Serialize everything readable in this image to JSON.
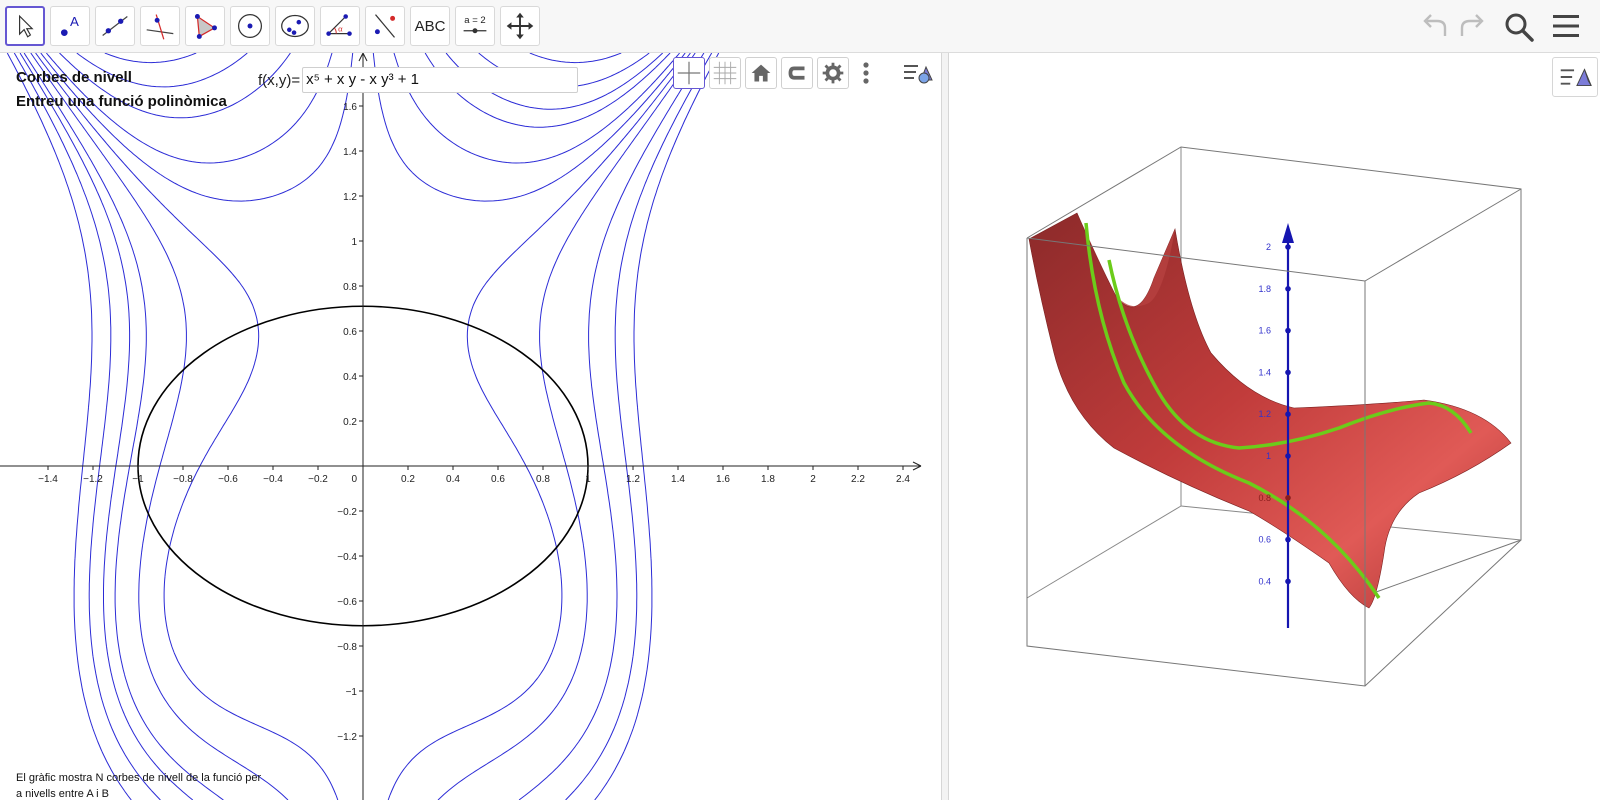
{
  "toolbar": {
    "tools": [
      {
        "id": "move",
        "name": "move-tool-button",
        "icon": "cursor-arrow-icon"
      },
      {
        "id": "point",
        "name": "point-tool-button",
        "icon": "point-icon",
        "text": "A"
      },
      {
        "id": "line",
        "name": "line-tool-button",
        "icon": "line-through-points-icon"
      },
      {
        "id": "perpendicular",
        "name": "perpendicular-line-tool-button",
        "icon": "perpendicular-line-icon"
      },
      {
        "id": "polygon",
        "name": "polygon-tool-button",
        "icon": "polygon-icon"
      },
      {
        "id": "circle",
        "name": "circle-tool-button",
        "icon": "circle-center-point-icon"
      },
      {
        "id": "conic",
        "name": "ellipse-tool-button",
        "icon": "ellipse-icon"
      },
      {
        "id": "angle",
        "name": "angle-tool-button",
        "icon": "angle-icon",
        "text": "α"
      },
      {
        "id": "reflect",
        "name": "reflect-tool-button",
        "icon": "reflect-about-line-icon"
      },
      {
        "id": "text",
        "name": "text-tool-button",
        "icon": "text-icon",
        "text": "ABC"
      },
      {
        "id": "slider",
        "name": "slider-tool-button",
        "icon": "slider-icon",
        "text": "a = 2"
      },
      {
        "id": "movegraphics",
        "name": "move-graphics-view-button",
        "icon": "move-arrows-icon"
      }
    ],
    "right": {
      "undo": "undo-icon",
      "redo": "redo-icon",
      "search": "search-icon",
      "menu": "hamburger-menu-icon"
    }
  },
  "graphics": {
    "title": "Corbes de nivell",
    "subtitle": "Entreu una funció polinòmica",
    "input": {
      "label": "f(x,y)=",
      "value": "x⁵ + x y - x y³ + 1"
    },
    "caption_line1": "El gràfic mostra N corbes de nivell de la funció per",
    "caption_line2": "a nivells entre A i B",
    "style_bar": {
      "axes": "axes-icon",
      "grid": "grid-icon",
      "home": "home-icon",
      "snap": "magnet-icon",
      "settings": "gear-icon",
      "more": "more-vertical-icon",
      "toggle": "style-bar-toggle-icon"
    },
    "x_ticks": [
      "-1.4",
      "-1.2",
      "-1",
      "-0.8",
      "-0.6",
      "-0.4",
      "-0.2",
      "0",
      "0.2",
      "0.4",
      "0.6",
      "0.8",
      "1",
      "1.2",
      "1.4",
      "1.6",
      "1.8",
      "2",
      "2.2",
      "2.4"
    ],
    "y_ticks": [
      "1.6",
      "1.4",
      "1.2",
      "1",
      "0.8",
      "0.6",
      "0.4",
      "0.2",
      "-0.2",
      "-0.4",
      "-0.6",
      "-0.8",
      "-1",
      "-1.2"
    ],
    "colors": {
      "contour": "#2b2bd6",
      "ellipse": "#000000",
      "axes": "#222222"
    }
  },
  "view3d": {
    "z_ticks": [
      "2",
      "1.8",
      "1.6",
      "1.4",
      "1.2",
      "1",
      "0.8",
      "0.6",
      "0.4"
    ],
    "style_toggle": "style-bar-toggle-icon",
    "colors": {
      "surface": "#c8403f",
      "curve": "#6ccc1a",
      "zaxis": "#1515b0",
      "box": "#555555"
    }
  }
}
